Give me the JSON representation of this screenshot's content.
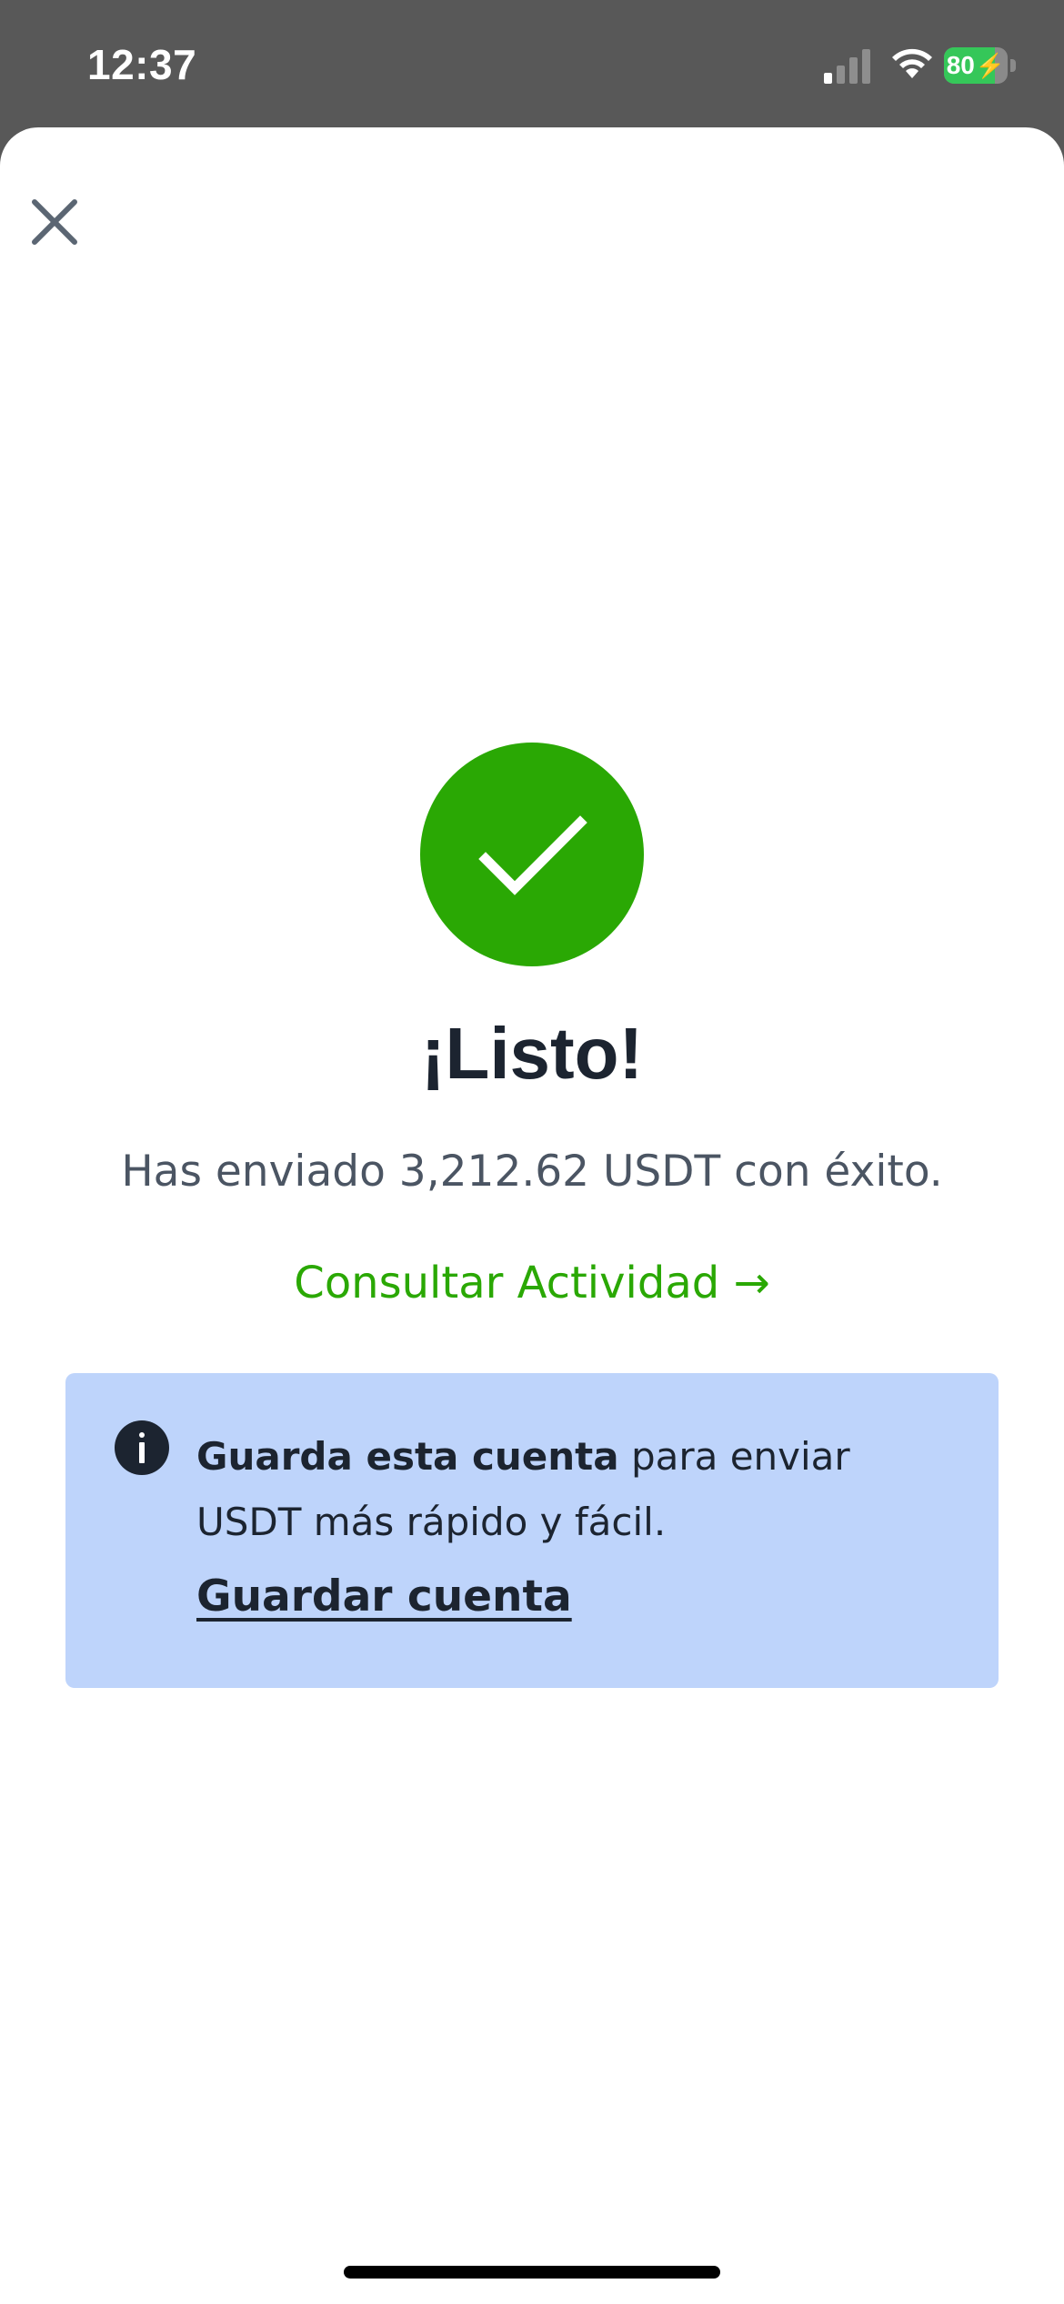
{
  "status_bar": {
    "time": "12:37",
    "battery_percent": "80",
    "battery_level": 0.8,
    "battery_color": "#35c759"
  },
  "header": {
    "close_icon": "close-icon"
  },
  "success": {
    "icon": "checkmark-icon",
    "color": "#2aa804",
    "title": "¡Listo!",
    "message": "Has enviado 3,212.62 USDT con éxito.",
    "activity_link": "Consultar Actividad →"
  },
  "info_card": {
    "background": "#bed4fb",
    "icon": "info-icon",
    "text_bold": "Guarda esta cuenta",
    "text_rest": " para enviar USDT más rápido y fácil.",
    "action_label": "Guardar cuenta"
  }
}
